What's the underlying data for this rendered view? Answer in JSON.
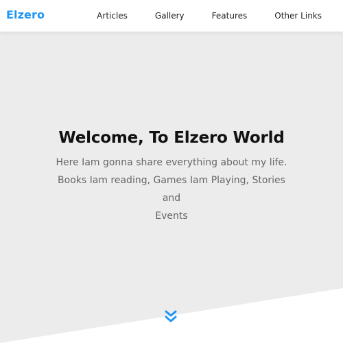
{
  "header": {
    "logo": "Elzero",
    "nav": [
      "Articles",
      "Gallery",
      "Features",
      "Other Links"
    ]
  },
  "hero": {
    "title": "Welcome, To Elzero World",
    "description": "Here Iam gonna share everything about my life.\nBooks Iam reading, Games Iam Playing, Stories and\nEvents"
  },
  "icons": {
    "scroll": "double-chevron-down-icon"
  },
  "colors": {
    "brand": "#2196f3",
    "hero_bg": "#ececec",
    "text_dark": "#111111",
    "text_muted": "#666666"
  }
}
